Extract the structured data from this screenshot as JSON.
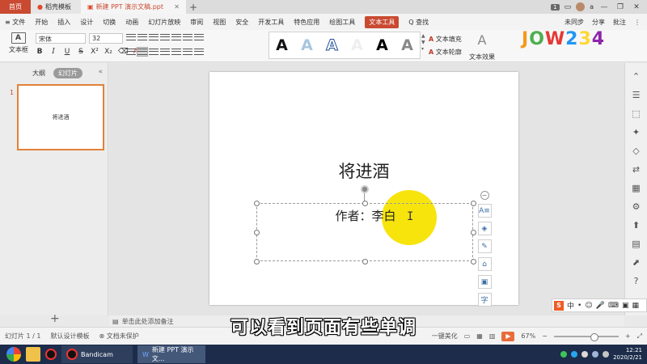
{
  "titlebar": {
    "home_tab": "首页",
    "templates_tab": "稻壳模板",
    "doc_tab": "新建 PPT 演示文稿.ppt",
    "new_tab": "+",
    "notif_count": "1",
    "user_initial": "a"
  },
  "menu": {
    "items": [
      "≡ 文件",
      "开始",
      "插入",
      "设计",
      "切换",
      "动画",
      "幻灯片放映",
      "审阅",
      "视图",
      "安全",
      "开发工具",
      "特色应用",
      "绘图工具",
      "文本工具"
    ],
    "active_index": 13,
    "search": "Q 查找",
    "sync": "未同步",
    "share": "分享",
    "comment": "批注"
  },
  "ribbon": {
    "textbox_label": "文本框",
    "font_name": "宋体",
    "font_size": "32",
    "gallery_glyph": "A",
    "text_fill": "文本填充",
    "text_outline": "文本轮廓",
    "text_effect": "文本效果"
  },
  "leftpanel": {
    "tab_outline": "大纲",
    "tab_slides": "幻灯片",
    "thumb_number": "1",
    "thumb_text": "将进酒",
    "add": "+"
  },
  "slide": {
    "title": "将进酒",
    "subtitle": "作者：李白",
    "cursor": "I"
  },
  "notes": {
    "placeholder": "单击此处添加备注"
  },
  "status": {
    "slide_count": "幻灯片 1 / 1",
    "template": "默认设计模板",
    "protect": "文档未保护",
    "beautify": "一键美化",
    "zoom": "67%"
  },
  "caption": "可以看到页面有些单调",
  "taskbar": {
    "bandicam": "Bandicam",
    "wps": "新建 PPT 演示文...",
    "time": "12:21",
    "date": "2020/2/21"
  },
  "colors": {
    "accent": "#c94a31",
    "highlight": "#f7e300"
  }
}
